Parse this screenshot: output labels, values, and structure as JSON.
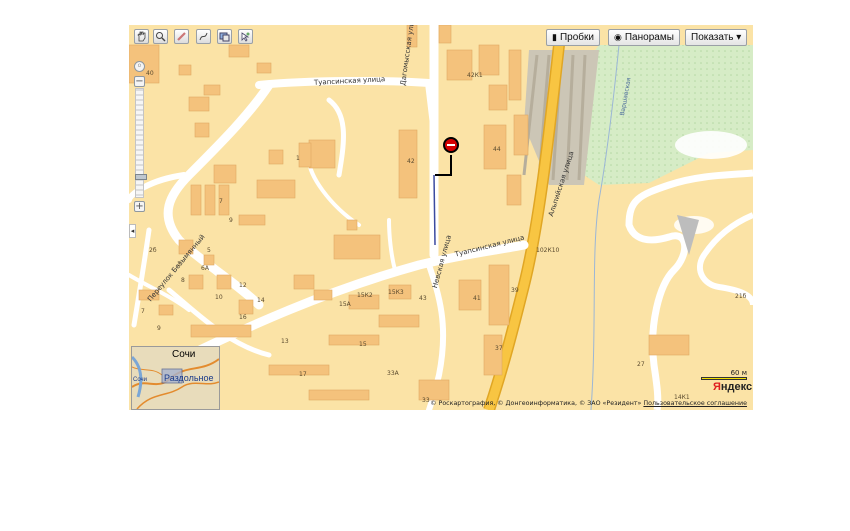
{
  "toolbar": {
    "tools": [
      "hand-icon",
      "magnifier-icon",
      "ruler-icon",
      "route-icon",
      "layers-icon",
      "selection-icon"
    ],
    "traffic_label": "Пробки",
    "panorama_label": "Панорамы",
    "show_label": "Показать ▾"
  },
  "map": {
    "streets": {
      "tuapsinskaya_top": "Туапсинская улица",
      "dagomysskaya": "Дагомысская улица",
      "tuapsinskaya_mid": "Туапсинская улица",
      "nevskaya": "Невская улица",
      "alpiyskaya": "Альпийская улица",
      "pereulok": "Переулок Безымянный",
      "varshavskaya": "Варшавская"
    },
    "house_numbers": {
      "h40": "40",
      "h42k1": "42К1",
      "h1": "1",
      "h42": "42",
      "h44": "44",
      "h7": "7",
      "h9": "9",
      "h2b": "2б",
      "h3": "3",
      "h6a": "6А",
      "h5": "5",
      "h8": "8",
      "h12": "12",
      "h10": "10",
      "h14": "14",
      "h16": "16",
      "h7b": "7",
      "h9b": "9",
      "h15a": "15А",
      "h15k2": "15К2",
      "h15k3": "15К3",
      "h43": "43",
      "h41": "41",
      "h39": "39",
      "h13": "13",
      "h15": "15",
      "h37": "37",
      "h17": "17",
      "h33a": "33А",
      "h33": "33",
      "h102k10": "102К10",
      "h21b": "21б",
      "h27": "27",
      "h14k1": "14К1"
    },
    "minimap": {
      "city": "Сочи",
      "town": "Раздольное",
      "edge_left": "Сочи"
    },
    "scale_label": "60 м",
    "logo": "Яндекс",
    "copyright": "© Роскартография, © Донгеоинформатика, © ЗАО «Резидент»",
    "terms_link": "Пользовательское соглашение"
  },
  "colors": {
    "land": "#fbe3a6",
    "building": "#f4c27c",
    "road": "#ffffff",
    "highway": "#f8c542",
    "park": "#d4ecc4",
    "rail": "#c7c1b4",
    "marker": "#d40000"
  }
}
